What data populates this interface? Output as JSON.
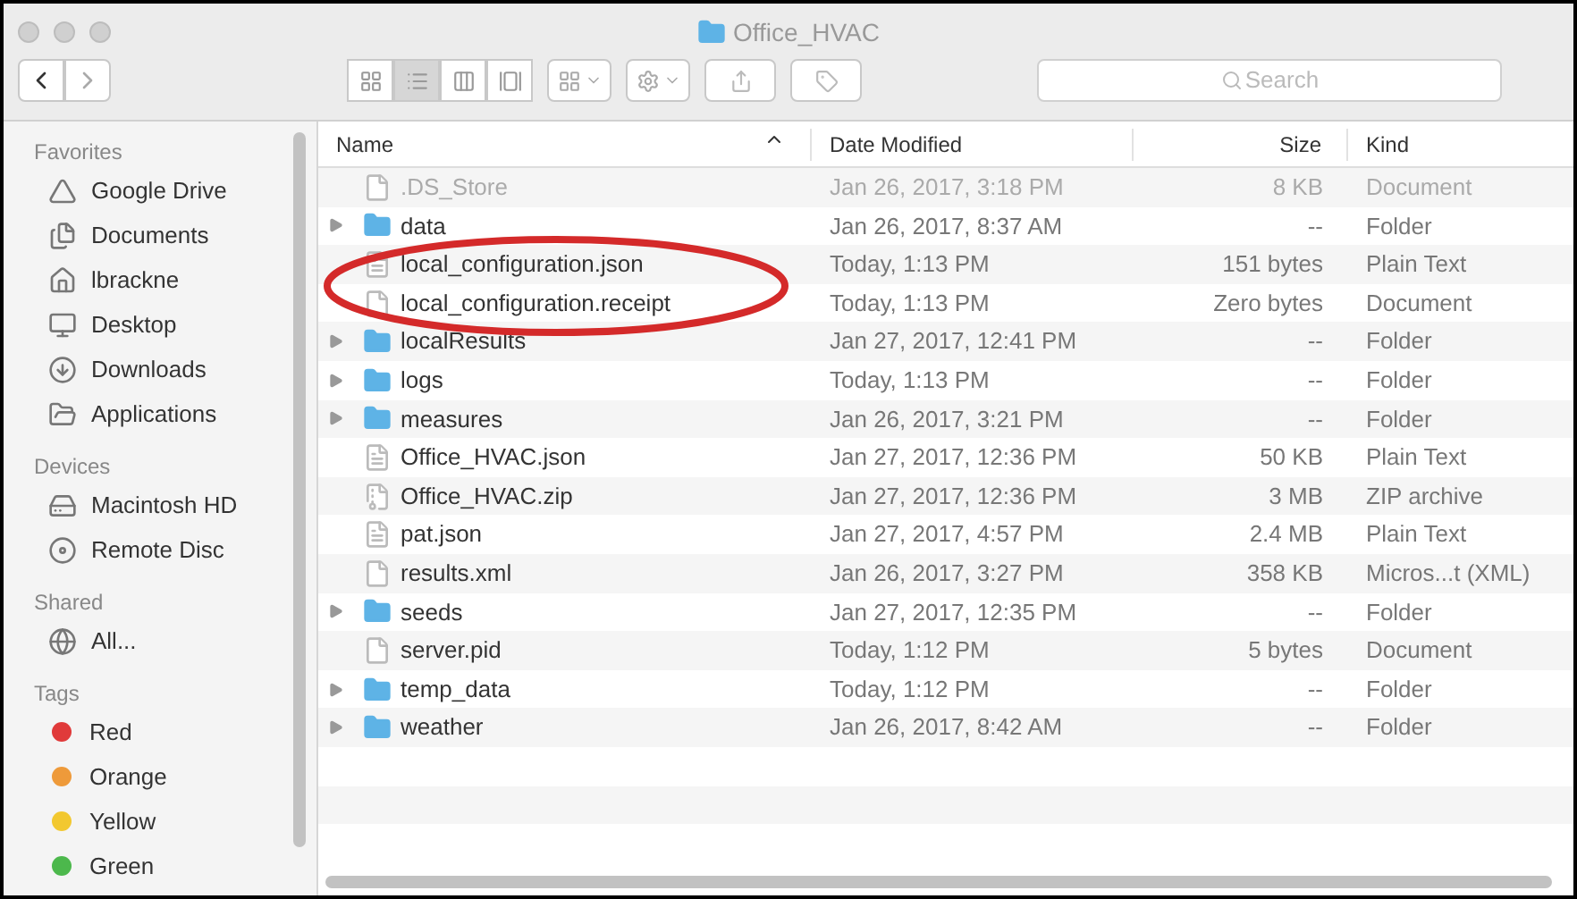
{
  "window": {
    "title": "Office_HVAC"
  },
  "toolbar": {
    "search_placeholder": "Search",
    "view_modes": [
      {
        "kind": "icons",
        "selected": false
      },
      {
        "kind": "list",
        "selected": true
      },
      {
        "kind": "columns",
        "selected": false
      },
      {
        "kind": "coverflow",
        "selected": false
      }
    ]
  },
  "sidebar": {
    "sections": [
      {
        "heading": "Favorites",
        "items": [
          {
            "label": "Google Drive",
            "kind": "drive"
          },
          {
            "label": "Documents",
            "kind": "documents"
          },
          {
            "label": "lbrackne",
            "kind": "home"
          },
          {
            "label": "Desktop",
            "kind": "desktop"
          },
          {
            "label": "Downloads",
            "kind": "downloads"
          },
          {
            "label": "Applications",
            "kind": "applications"
          }
        ]
      },
      {
        "heading": "Devices",
        "items": [
          {
            "label": "Macintosh HD",
            "kind": "disk"
          },
          {
            "label": "Remote Disc",
            "kind": "disc"
          }
        ]
      },
      {
        "heading": "Shared",
        "items": [
          {
            "label": "All...",
            "kind": "network"
          }
        ]
      },
      {
        "heading": "Tags",
        "items": [
          {
            "label": "Red",
            "kind": "tag",
            "color": "#e03a3a"
          },
          {
            "label": "Orange",
            "kind": "tag",
            "color": "#ee9a3a"
          },
          {
            "label": "Yellow",
            "kind": "tag",
            "color": "#f2c830"
          },
          {
            "label": "Green",
            "kind": "tag",
            "color": "#4cb84c"
          }
        ]
      }
    ]
  },
  "table": {
    "columns": [
      "Name",
      "Date Modified",
      "Size",
      "Kind"
    ],
    "rows": [
      {
        "name": ".DS_Store",
        "date": "Jan 26, 2017, 3:18 PM",
        "size": "8 KB",
        "kind_label": "Document",
        "kind": "document",
        "dimmed": true
      },
      {
        "name": "data",
        "date": "Jan 26, 2017, 8:37 AM",
        "size": "--",
        "kind_label": "Folder",
        "kind": "folder",
        "dimmed": false
      },
      {
        "name": "local_configuration.json",
        "date": "Today, 1:13 PM",
        "size": "151 bytes",
        "kind_label": "Plain Text",
        "kind": "text",
        "dimmed": false
      },
      {
        "name": "local_configuration.receipt",
        "date": "Today, 1:13 PM",
        "size": "Zero bytes",
        "kind_label": "Document",
        "kind": "document",
        "dimmed": false
      },
      {
        "name": "localResults",
        "date": "Jan 27, 2017, 12:41 PM",
        "size": "--",
        "kind_label": "Folder",
        "kind": "folder",
        "dimmed": false
      },
      {
        "name": "logs",
        "date": "Today, 1:13 PM",
        "size": "--",
        "kind_label": "Folder",
        "kind": "folder",
        "dimmed": false
      },
      {
        "name": "measures",
        "date": "Jan 26, 2017, 3:21 PM",
        "size": "--",
        "kind_label": "Folder",
        "kind": "folder",
        "dimmed": false
      },
      {
        "name": "Office_HVAC.json",
        "date": "Jan 27, 2017, 12:36 PM",
        "size": "50 KB",
        "kind_label": "Plain Text",
        "kind": "text",
        "dimmed": false
      },
      {
        "name": "Office_HVAC.zip",
        "date": "Jan 27, 2017, 12:36 PM",
        "size": "3 MB",
        "kind_label": "ZIP archive",
        "kind": "zip",
        "dimmed": false
      },
      {
        "name": "pat.json",
        "date": "Jan 27, 2017, 4:57 PM",
        "size": "2.4 MB",
        "kind_label": "Plain Text",
        "kind": "text",
        "dimmed": false
      },
      {
        "name": "results.xml",
        "date": "Jan 26, 2017, 3:27 PM",
        "size": "358 KB",
        "kind_label": "Micros...t (XML)",
        "kind": "document",
        "dimmed": false
      },
      {
        "name": "seeds",
        "date": "Jan 27, 2017, 12:35 PM",
        "size": "--",
        "kind_label": "Folder",
        "kind": "folder",
        "dimmed": false
      },
      {
        "name": "server.pid",
        "date": "Today, 1:12 PM",
        "size": "5 bytes",
        "kind_label": "Document",
        "kind": "document",
        "dimmed": false
      },
      {
        "name": "temp_data",
        "date": "Today, 1:12 PM",
        "size": "--",
        "kind_label": "Folder",
        "kind": "folder",
        "dimmed": false
      },
      {
        "name": "weather",
        "date": "Jan 26, 2017, 8:42 AM",
        "size": "--",
        "kind_label": "Folder",
        "kind": "folder",
        "dimmed": false
      }
    ]
  }
}
